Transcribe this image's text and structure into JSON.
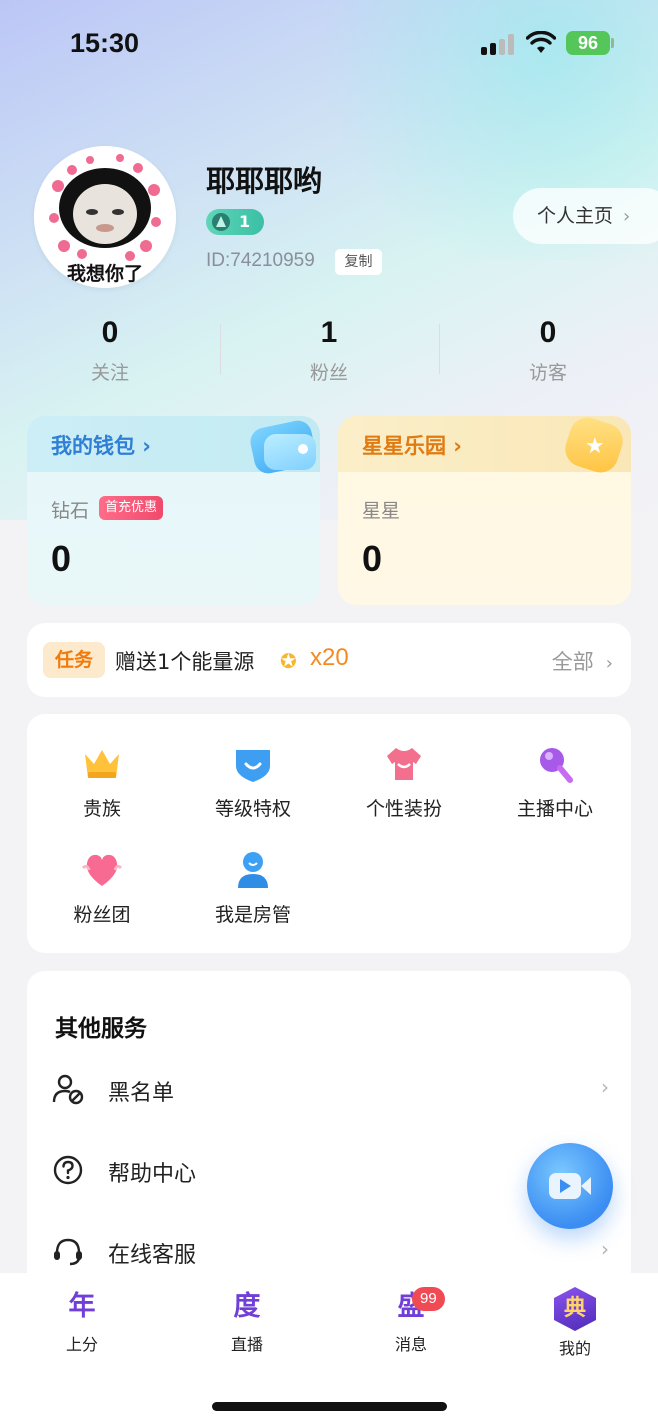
{
  "status_bar": {
    "time": "15:30",
    "battery": "96"
  },
  "profile": {
    "avatar_caption": "我想你了",
    "nickname": "耶耶耶哟",
    "level": "1",
    "user_id": "ID:74210959",
    "copy_label": "复制",
    "homepage_label": "个人主页"
  },
  "stats": [
    {
      "value": "0",
      "label": "关注"
    },
    {
      "value": "1",
      "label": "粉丝"
    },
    {
      "value": "0",
      "label": "访客"
    }
  ],
  "wallet": {
    "title": "我的钱包",
    "label": "钻石",
    "promo": "首充优惠",
    "value": "0"
  },
  "star_park": {
    "title": "星星乐园",
    "label": "星星",
    "value": "0"
  },
  "task": {
    "tag": "任务",
    "text": "赠送1个能量源",
    "count": "x20",
    "all_label": "全部"
  },
  "features": [
    {
      "label": "贵族",
      "icon": "crown-icon"
    },
    {
      "label": "等级特权",
      "icon": "shield-icon"
    },
    {
      "label": "个性装扮",
      "icon": "shirt-icon"
    },
    {
      "label": "主播中心",
      "icon": "microphone-icon"
    },
    {
      "label": "粉丝团",
      "icon": "heart-icon"
    },
    {
      "label": "我是房管",
      "icon": "user-icon"
    }
  ],
  "services": {
    "title": "其他服务",
    "items": [
      {
        "label": "黑名单",
        "icon": "user-block-icon"
      },
      {
        "label": "帮助中心",
        "icon": "help-icon"
      },
      {
        "label": "在线客服",
        "icon": "headset-icon"
      }
    ]
  },
  "tabbar": {
    "items": [
      {
        "glyph": "年",
        "label": "上分"
      },
      {
        "glyph": "度",
        "label": "直播"
      },
      {
        "glyph": "盛",
        "label": "消息"
      },
      {
        "glyph": "典",
        "label": "我的"
      }
    ],
    "message_badge": "99"
  },
  "colors": {
    "accent_purple": "#6f3fd8",
    "wallet_blue": "#2f7fd6",
    "star_orange": "#e07b12",
    "badge_red": "#f04b55"
  }
}
